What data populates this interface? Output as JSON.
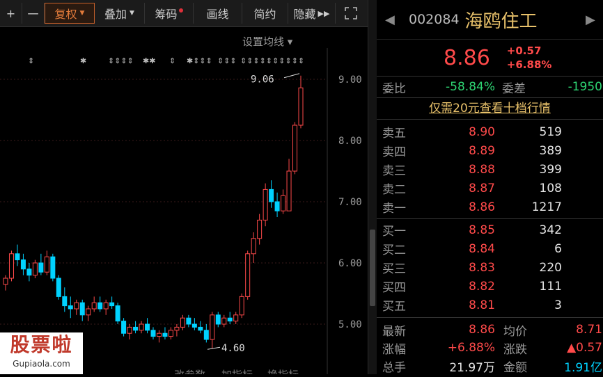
{
  "toolbar": {
    "plus": "+",
    "minus": "一",
    "fuquan": "复权",
    "diejia": "叠加",
    "chouma": "筹码",
    "huaxian": "画线",
    "jianyue": "简约",
    "yincang": "隐藏"
  },
  "chart": {
    "set_ma": "设置均线",
    "price_labels": [
      "9.00",
      "8.00",
      "7.00",
      "6.00",
      "5.00"
    ],
    "high_annot": "9.06",
    "low_annot": "4.60",
    "bottom_tabs": [
      "改参数",
      "加指标",
      "换指标"
    ]
  },
  "chart_data": {
    "type": "candlestick",
    "ylim": [
      4.35,
      9.3
    ],
    "high": 9.06,
    "low": 4.6,
    "candles": [
      [
        5.65,
        5.8,
        5.55,
        5.75
      ],
      [
        5.75,
        6.2,
        5.7,
        6.15
      ],
      [
        6.15,
        6.3,
        5.95,
        6.05
      ],
      [
        6.05,
        6.15,
        5.8,
        5.9
      ],
      [
        5.9,
        6.0,
        5.7,
        5.8
      ],
      [
        5.8,
        6.05,
        5.75,
        6.0
      ],
      [
        6.0,
        6.15,
        5.8,
        5.85
      ],
      [
        5.85,
        6.2,
        5.8,
        6.1
      ],
      [
        6.1,
        6.15,
        5.7,
        5.75
      ],
      [
        5.75,
        5.8,
        5.4,
        5.45
      ],
      [
        5.45,
        5.6,
        5.2,
        5.3
      ],
      [
        5.3,
        5.45,
        5.1,
        5.25
      ],
      [
        5.25,
        5.4,
        5.15,
        5.35
      ],
      [
        5.35,
        5.4,
        5.05,
        5.15
      ],
      [
        5.15,
        5.3,
        5.05,
        5.25
      ],
      [
        5.25,
        5.45,
        5.2,
        5.35
      ],
      [
        5.35,
        5.45,
        5.2,
        5.25
      ],
      [
        5.25,
        5.4,
        5.15,
        5.35
      ],
      [
        5.35,
        5.45,
        5.25,
        5.3
      ],
      [
        5.3,
        5.35,
        5.0,
        5.05
      ],
      [
        5.05,
        5.1,
        4.8,
        4.85
      ],
      [
        4.85,
        5.0,
        4.75,
        4.95
      ],
      [
        4.95,
        5.05,
        4.85,
        4.9
      ],
      [
        4.9,
        5.05,
        4.85,
        5.0
      ],
      [
        5.0,
        5.1,
        4.85,
        4.9
      ],
      [
        4.9,
        4.95,
        4.75,
        4.8
      ],
      [
        4.8,
        4.9,
        4.7,
        4.85
      ],
      [
        4.85,
        4.95,
        4.75,
        4.8
      ],
      [
        4.8,
        4.95,
        4.75,
        4.9
      ],
      [
        4.9,
        5.0,
        4.8,
        4.95
      ],
      [
        4.95,
        5.15,
        4.9,
        5.1
      ],
      [
        5.1,
        5.15,
        4.95,
        5.0
      ],
      [
        5.0,
        5.1,
        4.9,
        4.95
      ],
      [
        4.95,
        5.05,
        4.85,
        4.9
      ],
      [
        4.9,
        5.0,
        4.7,
        4.75
      ],
      [
        4.75,
        5.2,
        4.6,
        5.15
      ],
      [
        5.15,
        5.2,
        4.95,
        5.0
      ],
      [
        5.0,
        5.15,
        4.95,
        5.1
      ],
      [
        5.1,
        5.2,
        5.0,
        5.05
      ],
      [
        5.05,
        5.2,
        5.0,
        5.15
      ],
      [
        5.15,
        5.5,
        5.1,
        5.45
      ],
      [
        5.45,
        6.2,
        5.4,
        6.15
      ],
      [
        6.15,
        6.5,
        6.0,
        6.4
      ],
      [
        6.4,
        6.8,
        6.3,
        6.7
      ],
      [
        6.7,
        7.3,
        6.6,
        7.2
      ],
      [
        7.2,
        7.35,
        6.9,
        7.0
      ],
      [
        7.0,
        7.15,
        6.75,
        6.85
      ],
      [
        6.85,
        7.2,
        6.8,
        7.1
      ],
      [
        6.85,
        7.7,
        6.85,
        7.5
      ],
      [
        7.5,
        8.3,
        7.45,
        8.25
      ],
      [
        8.25,
        9.06,
        8.2,
        8.86
      ]
    ]
  },
  "stock": {
    "code": "002084",
    "name": "海鸥住工",
    "price": "8.86",
    "change": "+0.57",
    "change_pct": "+6.88%"
  },
  "weibi": {
    "label": "委比",
    "value": "-58.84%",
    "diff_label": "委差",
    "diff_value": "-1950"
  },
  "promo": "仅需20元查看十档行情",
  "asks": [
    {
      "label": "卖五",
      "price": "8.90",
      "vol": "519"
    },
    {
      "label": "卖四",
      "price": "8.89",
      "vol": "389"
    },
    {
      "label": "卖三",
      "price": "8.88",
      "vol": "399"
    },
    {
      "label": "卖二",
      "price": "8.87",
      "vol": "108"
    },
    {
      "label": "卖一",
      "price": "8.86",
      "vol": "1217"
    }
  ],
  "bids": [
    {
      "label": "买一",
      "price": "8.85",
      "vol": "342"
    },
    {
      "label": "买二",
      "price": "8.84",
      "vol": "6"
    },
    {
      "label": "买三",
      "price": "8.83",
      "vol": "220"
    },
    {
      "label": "买四",
      "price": "8.82",
      "vol": "111"
    },
    {
      "label": "买五",
      "price": "8.81",
      "vol": "3"
    }
  ],
  "stats": {
    "latest_label": "最新",
    "latest": "8.86",
    "avg_label": "均价",
    "avg": "8.71",
    "pct_label": "涨幅",
    "pct": "+6.88%",
    "chg_label": "涨跌",
    "chg": "▲0.57",
    "vol_label": "总手",
    "vol": "21.97万",
    "amt_label": "金额",
    "amt": "1.91亿"
  },
  "watermark": {
    "brand": "股票啦",
    "site": "Gupiaola.com"
  },
  "colors": {
    "up": "#ff4a4a",
    "down": "#00d2ff",
    "accent": "#e8c16a",
    "green": "#2ed573"
  }
}
